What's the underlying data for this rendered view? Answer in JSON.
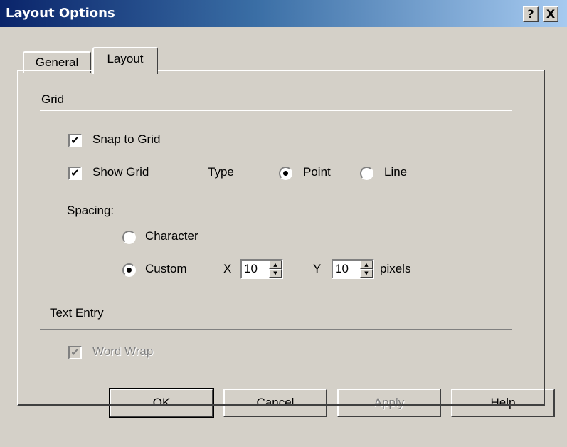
{
  "window": {
    "title": "Layout Options",
    "help_button": "?",
    "close_button": "X"
  },
  "tabs": [
    {
      "label": "General",
      "active": false
    },
    {
      "label": "Layout",
      "active": true
    }
  ],
  "grid": {
    "heading": "Grid",
    "snap_to_grid": {
      "label": "Snap to Grid",
      "checked": true
    },
    "show_grid": {
      "label": "Show Grid",
      "checked": true
    },
    "type_label": "Type",
    "type_options": [
      {
        "label": "Point",
        "selected": true
      },
      {
        "label": "Line",
        "selected": false
      }
    ],
    "spacing_label": "Spacing:",
    "spacing_options": [
      {
        "label": "Character",
        "selected": false
      },
      {
        "label": "Custom",
        "selected": true
      }
    ],
    "x_label": "X",
    "x_value": "10",
    "y_label": "Y",
    "y_value": "10",
    "units": "pixels"
  },
  "text_entry": {
    "heading": "Text Entry",
    "word_wrap": {
      "label": "Word Wrap",
      "checked": true,
      "enabled": false
    }
  },
  "buttons": {
    "ok": "OK",
    "cancel": "Cancel",
    "apply": "Apply",
    "help": "Help"
  },
  "glyphs": {
    "check": "✔",
    "spin_up": "▲",
    "spin_down": "▼"
  }
}
